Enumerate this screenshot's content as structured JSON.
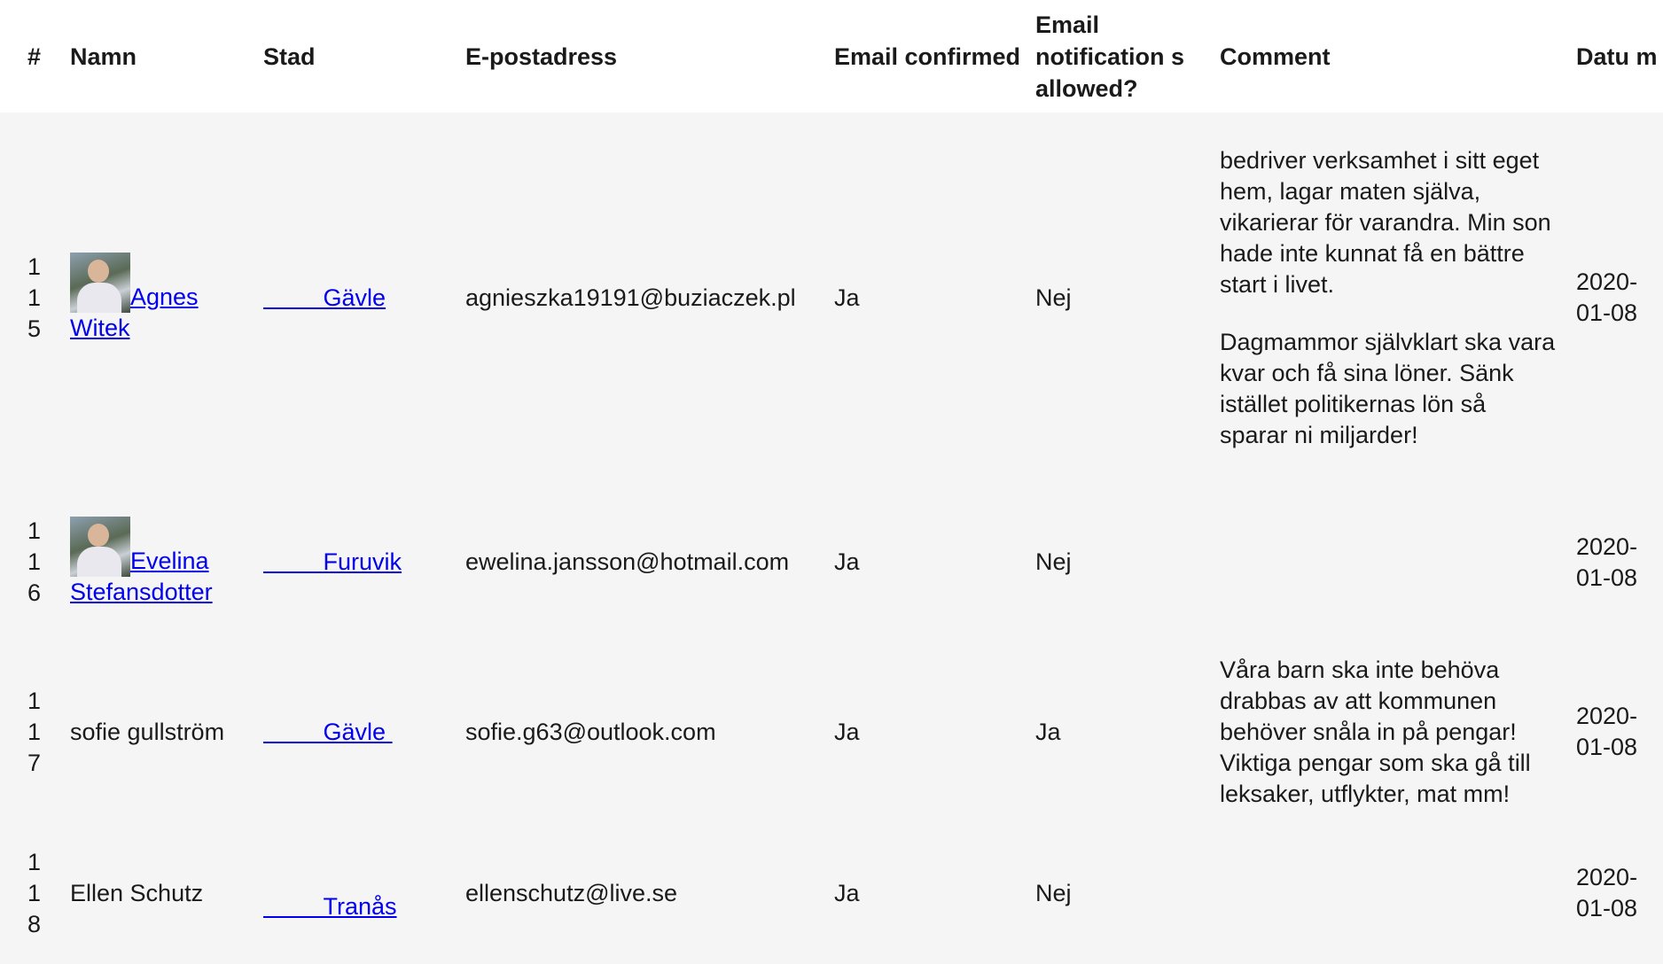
{
  "headers": {
    "num": "#",
    "name": "Namn",
    "city": "Stad",
    "email": "E-postadress",
    "confirmed": "Email confirmed",
    "notifications": "Email notification s allowed?",
    "comment": "Comment",
    "date": "Datu m"
  },
  "rows": [
    {
      "num": "115",
      "name": "Agnes Witek",
      "has_avatar": true,
      "city": "Gävle",
      "email": "agnieszka19191@buziaczek.pl",
      "confirmed": "Ja",
      "notifications": "Nej",
      "comment": [
        "bedriver verksamhet i sitt eget hem, lagar maten själva, vikarierar för varandra. Min son hade inte kunnat få en bättre start i livet.",
        "Dagmammor självklart ska vara kvar och få sina löner. Sänk istället politikernas lön så sparar ni miljarder!"
      ],
      "date": "2020-01-08"
    },
    {
      "num": "116",
      "name": "Evelina Stefansdotter",
      "has_avatar": true,
      "city": "Furuvik",
      "email": "ewelina.jansson@hotmail.com",
      "confirmed": "Ja",
      "notifications": "Nej",
      "comment": [],
      "date": "2020-01-08"
    },
    {
      "num": "117",
      "name": "sofie gullström",
      "has_avatar": false,
      "city": "Gävle",
      "email": "sofie.g63@outlook.com",
      "confirmed": "Ja",
      "notifications": "Ja",
      "comment": [
        "Våra barn ska inte behöva drabbas av att kommunen behöver snåla in på pengar! Viktiga pengar som ska gå till leksaker, utflykter, mat mm!"
      ],
      "date": "2020-01-08"
    },
    {
      "num": "118",
      "name": "Ellen Schutz",
      "has_avatar": false,
      "city": "Tranås",
      "email": "ellenschutz@live.se",
      "confirmed": "Ja",
      "notifications": "Nej",
      "comment": [],
      "date": "2020-01-08"
    }
  ]
}
